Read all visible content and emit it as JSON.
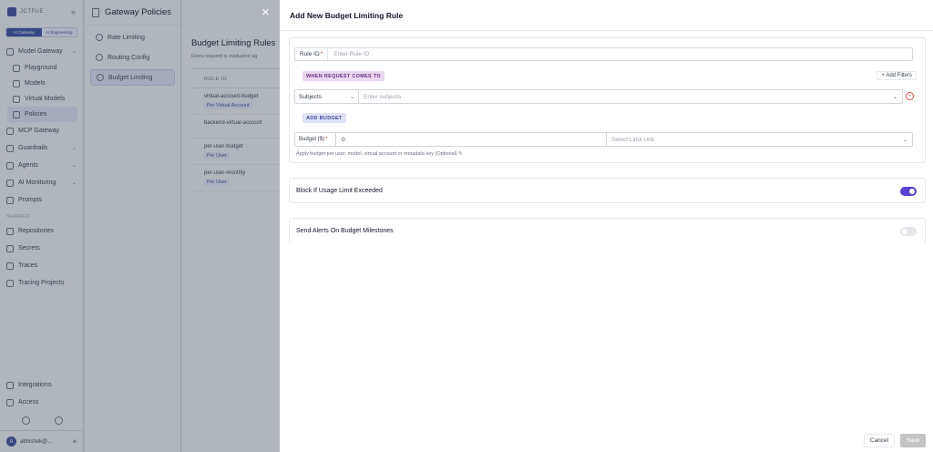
{
  "sidebar": {
    "logo_text": "JCTFUE",
    "segments": [
      "AI Gateway",
      "AI Engineering"
    ],
    "items": [
      {
        "label": "Model Gateway",
        "chev": "⌄"
      },
      {
        "label": "Playground"
      },
      {
        "label": "Models"
      },
      {
        "label": "Virtual Models"
      },
      {
        "label": "Policies"
      },
      {
        "label": "MCP Gateway"
      },
      {
        "label": "Guardrails",
        "chev": "⌄"
      },
      {
        "label": "Agents",
        "chev": "⌄"
      },
      {
        "label": "AI Monitoring",
        "chev": "⌄"
      },
      {
        "label": "Prompts"
      }
    ],
    "shared_label": "SHARED",
    "shared_items": [
      {
        "label": "Repositories"
      },
      {
        "label": "Secrets"
      },
      {
        "label": "Traces"
      },
      {
        "label": "Tracing Projects"
      }
    ],
    "bottom_items": [
      {
        "label": "Integrations"
      },
      {
        "label": "Access"
      }
    ],
    "user": {
      "initial": "A",
      "name": "abhishek@..."
    }
  },
  "policy_panel": {
    "title": "Gateway Policies",
    "items": [
      "Rate Limiting",
      "Routing Config",
      "Budget Limiting"
    ]
  },
  "main": {
    "title": "Budget Limiting Rules",
    "subtitle": "Every request is evaluated ag",
    "column_header": "RULE ID",
    "rules": [
      {
        "id": "virtual-account-budget",
        "tag": "Per Virtual Account"
      },
      {
        "id": "backend-virtual-account",
        "tag": ""
      },
      {
        "id": "per-user-budget",
        "tag": "Per User"
      },
      {
        "id": "per-user-monthly",
        "tag": "Per User"
      }
    ]
  },
  "drawer": {
    "close_icon": "×",
    "title": "Add New Budget Limiting Rule",
    "rule_id_label": "Rule ID",
    "rule_id_placeholder": "Enter Rule ID",
    "when_label": "WHEN REQUEST COMES TO",
    "add_filters": "+ Add Filters",
    "subjects_select": "Subjects",
    "subjects_placeholder": "Enter subjects",
    "add_budget_label": "ADD BUDGET",
    "budget_label": "Budget ($)",
    "budget_value": "0",
    "limit_unit_placeholder": "Select Limit Unit",
    "hint": "Apply budget per user, model, virtual account or metadata key (Optional)",
    "block_label": "Block If Usage Limit Exceeded",
    "block_on": true,
    "alerts_label": "Send Alerts On Budget Milestones",
    "alerts_on": false,
    "cancel_label": "Cancel",
    "save_label": "Save"
  },
  "colors": {
    "accent": "#3b4aa3",
    "toggle_on": "#5b3fd6",
    "when_pill": "#ead7f0"
  }
}
